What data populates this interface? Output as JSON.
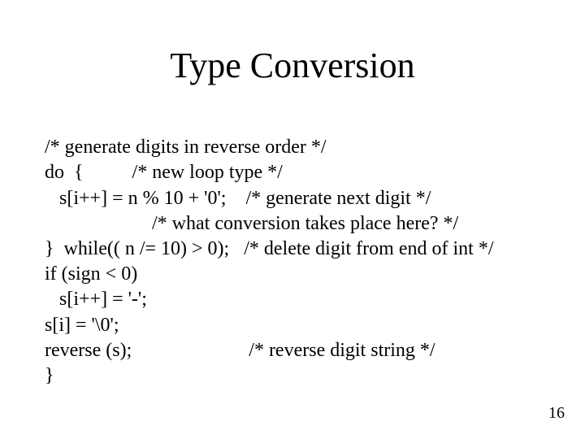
{
  "title": "Type Conversion",
  "code": {
    "l1": "/* generate digits in reverse order */",
    "l2": "do  {          /* new loop type */",
    "l3": "   s[i++] = n % 10 + '0';    /* generate next digit */",
    "l4": "                      /* what conversion takes place here? */",
    "l5": "}  while(( n /= 10) > 0);   /* delete digit from end of int */",
    "l6": "if (sign < 0)",
    "l7": "   s[i++] = '-';",
    "l8": "s[i] = '\\0';",
    "l9": "reverse (s);                        /* reverse digit string */",
    "l10": "}"
  },
  "page_number": "16"
}
